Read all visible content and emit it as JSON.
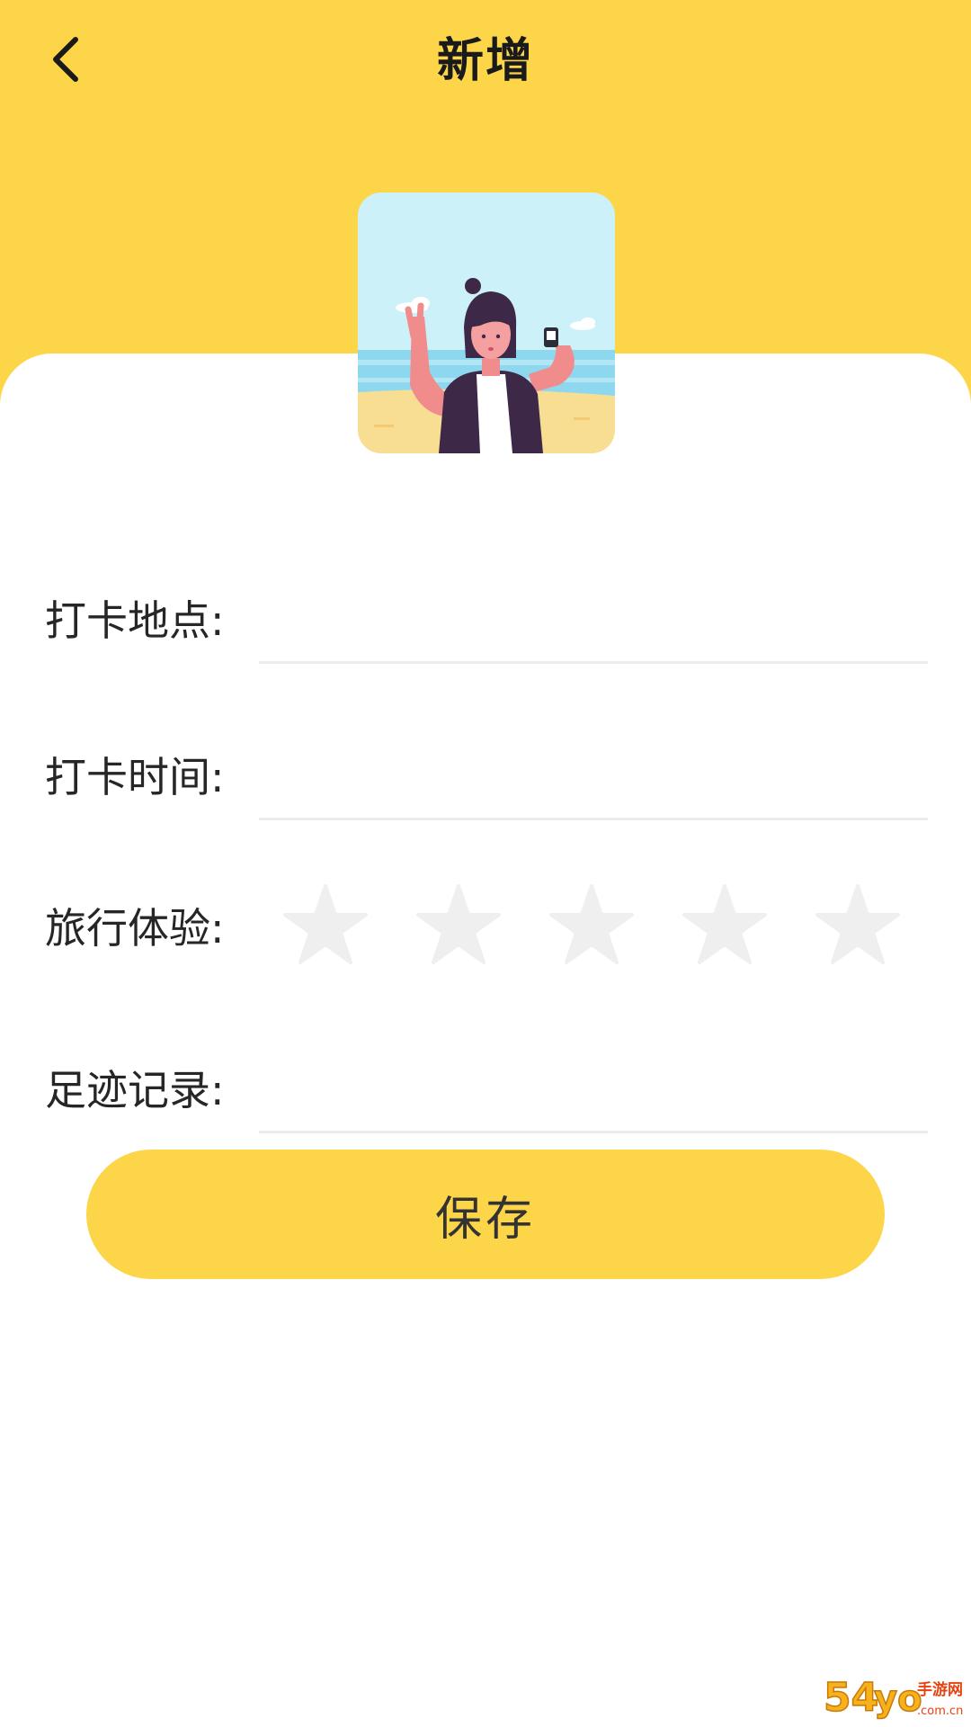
{
  "header": {
    "title": "新增",
    "back_icon": "chevron-left-icon",
    "background_color": "#FDD549"
  },
  "cover": {
    "description_icon": "selfie-beach-illustration"
  },
  "form": {
    "location": {
      "label": "打卡地点:",
      "value": ""
    },
    "time": {
      "label": "打卡时间:",
      "value": ""
    },
    "experience": {
      "label": "旅行体验:",
      "rating": 0,
      "max": 5,
      "star_color": "#EFEFEF"
    },
    "footprint": {
      "label": "足迹记录:",
      "value": ""
    }
  },
  "actions": {
    "save_label": "保存"
  },
  "watermark": {
    "brand_primary": "54",
    "brand_secondary": "手游网",
    "domain": ".com.cn"
  }
}
